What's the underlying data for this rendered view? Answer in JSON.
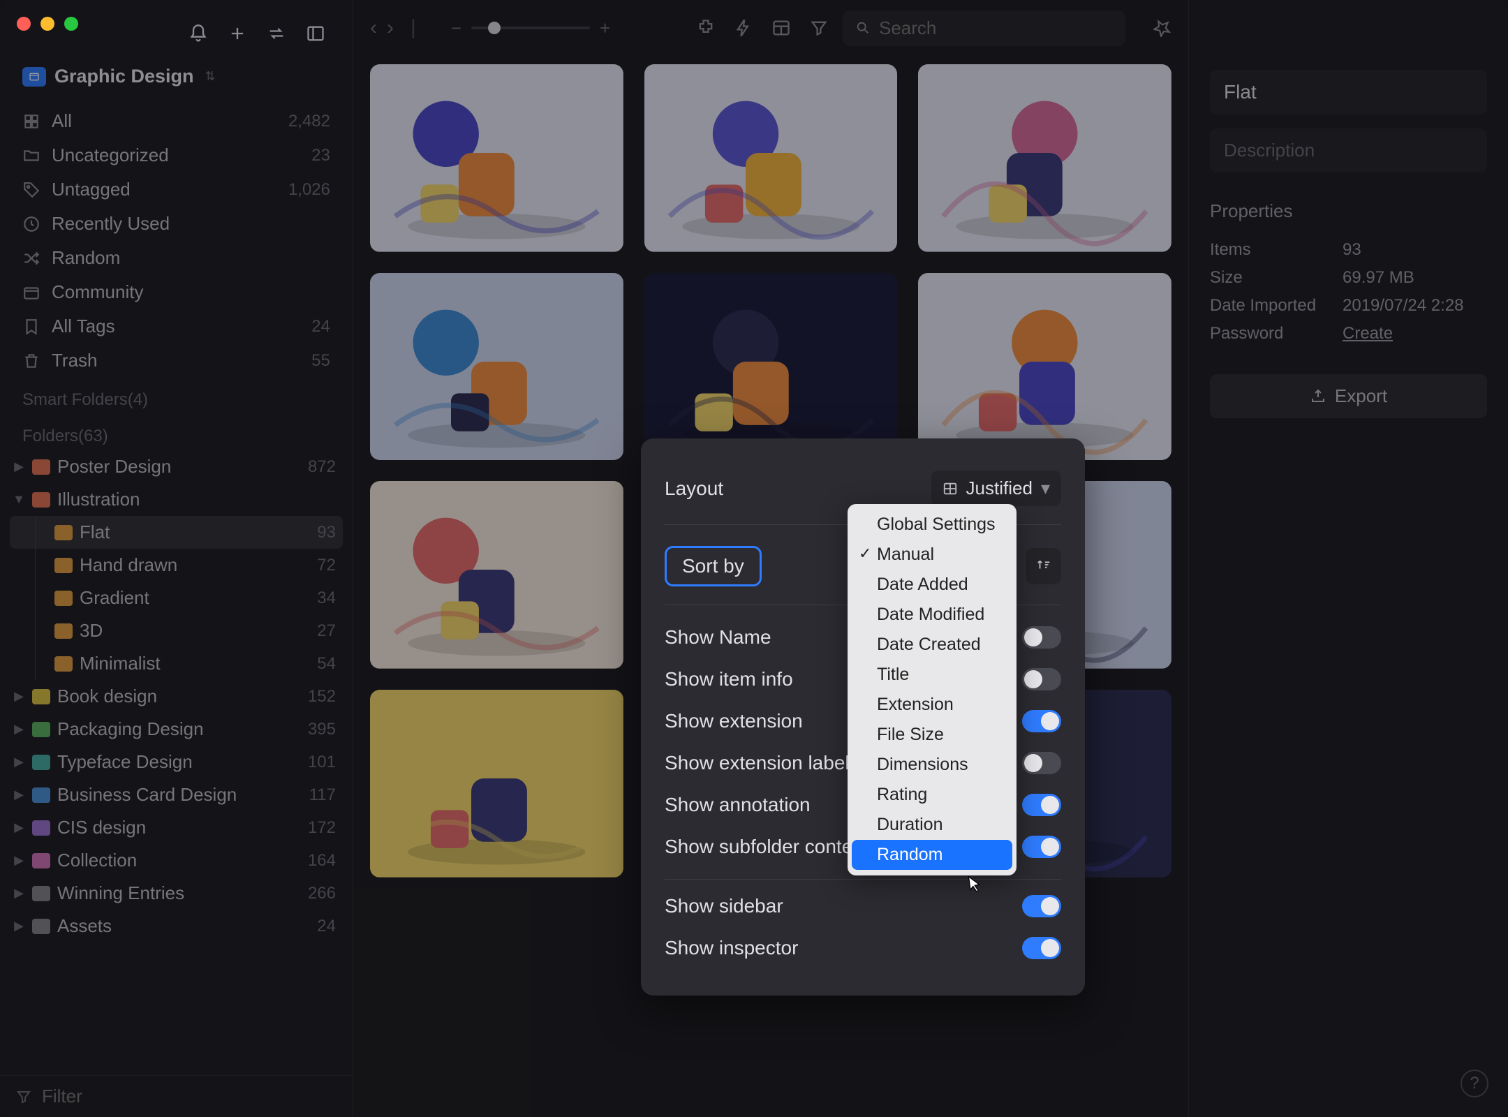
{
  "library": {
    "name": "Graphic Design"
  },
  "sidebar": {
    "smartItems": [
      {
        "icon": "all",
        "label": "All",
        "count": "2,482"
      },
      {
        "icon": "folder",
        "label": "Uncategorized",
        "count": "23"
      },
      {
        "icon": "tag",
        "label": "Untagged",
        "count": "1,026"
      },
      {
        "icon": "clock",
        "label": "Recently Used",
        "count": ""
      },
      {
        "icon": "shuffle",
        "label": "Random",
        "count": ""
      },
      {
        "icon": "community",
        "label": "Community",
        "count": ""
      },
      {
        "icon": "bookmark",
        "label": "All Tags",
        "count": "24"
      },
      {
        "icon": "trash",
        "label": "Trash",
        "count": "55"
      }
    ],
    "smartFoldersHeader": "Smart Folders(4)",
    "foldersHeader": "Folders(63)",
    "folders": [
      {
        "label": "Poster Design",
        "count": "872",
        "color": "red",
        "expanded": false
      },
      {
        "label": "Illustration",
        "count": "",
        "color": "red",
        "expanded": true,
        "children": [
          {
            "label": "Flat",
            "count": "93",
            "color": "orange",
            "selected": true
          },
          {
            "label": "Hand drawn",
            "count": "72",
            "color": "orange"
          },
          {
            "label": "Gradient",
            "count": "34",
            "color": "orange"
          },
          {
            "label": "3D",
            "count": "27",
            "color": "orange"
          },
          {
            "label": "Minimalist",
            "count": "54",
            "color": "orange"
          }
        ]
      },
      {
        "label": "Book design",
        "count": "152",
        "color": "yellow"
      },
      {
        "label": "Packaging Design",
        "count": "395",
        "color": "green"
      },
      {
        "label": "Typeface Design",
        "count": "101",
        "color": "teal"
      },
      {
        "label": "Business Card Design",
        "count": "117",
        "color": "blue"
      },
      {
        "label": "CIS design",
        "count": "172",
        "color": "purple"
      },
      {
        "label": "Collection",
        "count": "164",
        "color": "pink"
      },
      {
        "label": "Winning Entries",
        "count": "266",
        "color": "gray"
      },
      {
        "label": "Assets",
        "count": "24",
        "color": "gray"
      }
    ],
    "filterPlaceholder": "Filter"
  },
  "toolbar": {
    "searchPlaceholder": "Search"
  },
  "inspector": {
    "title": "Flat",
    "descriptionPlaceholder": "Description",
    "propertiesLabel": "Properties",
    "props": {
      "itemsK": "Items",
      "itemsV": "93",
      "sizeK": "Size",
      "sizeV": "69.97 MB",
      "dateK": "Date Imported",
      "dateV": "2019/07/24 2:28",
      "pwK": "Password",
      "pwV": "Create"
    },
    "exportLabel": "Export"
  },
  "popover": {
    "layoutLabel": "Layout",
    "layoutValue": "Justified",
    "sortByLabel": "Sort by",
    "rows": [
      {
        "label": "Show Name",
        "on": false
      },
      {
        "label": "Show item info",
        "on": false
      },
      {
        "label": "Show extension",
        "on": true
      },
      {
        "label": "Show extension label",
        "on": false
      },
      {
        "label": "Show annotation",
        "on": true
      },
      {
        "label": "Show subfolder content",
        "on": true
      }
    ],
    "rows2": [
      {
        "label": "Show sidebar",
        "on": true
      },
      {
        "label": "Show inspector",
        "on": true
      }
    ]
  },
  "dropdown": {
    "items": [
      {
        "label": "Global Settings"
      },
      {
        "label": "Manual",
        "checked": true
      },
      {
        "label": "Date Added"
      },
      {
        "label": "Date Modified"
      },
      {
        "label": "Date Created"
      },
      {
        "label": "Title"
      },
      {
        "label": "Extension"
      },
      {
        "label": "File Size"
      },
      {
        "label": "Dimensions"
      },
      {
        "label": "Rating"
      },
      {
        "label": "Duration"
      },
      {
        "label": "Random",
        "hover": true
      }
    ]
  }
}
